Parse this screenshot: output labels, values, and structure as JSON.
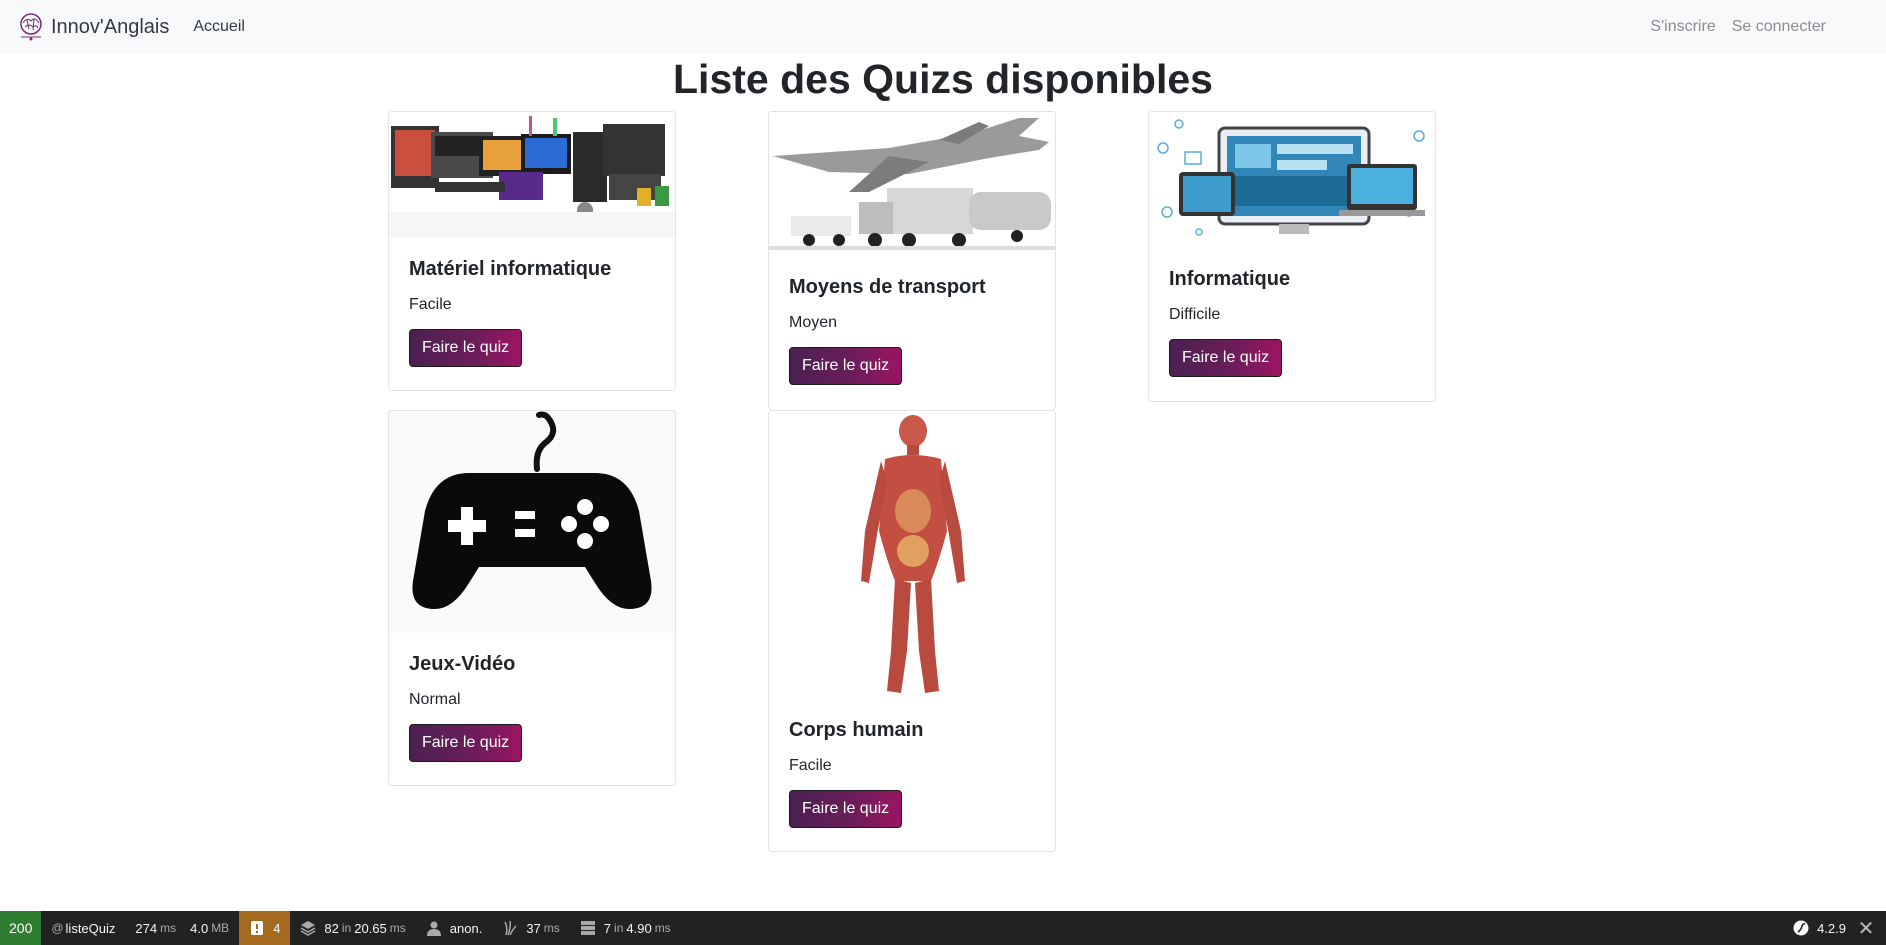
{
  "nav": {
    "brand": "Innov'Anglais",
    "home": "Accueil",
    "register": "S'inscrire",
    "login": "Se connecter"
  },
  "page_title": "Liste des Quizs disponibles",
  "quizzes": [
    {
      "title": "Matériel informatique",
      "level": "Facile",
      "button": "Faire le quiz",
      "image": "computer-hardware"
    },
    {
      "title": "Moyens de transport",
      "level": "Moyen",
      "button": "Faire le quiz",
      "image": "transport-vehicles"
    },
    {
      "title": "Informatique",
      "level": "Difficile",
      "button": "Faire le quiz",
      "image": "devices-network"
    },
    {
      "title": "Jeux-Vidéo",
      "level": "Normal",
      "button": "Faire le quiz",
      "image": "game-controller"
    },
    {
      "title": "Corps humain",
      "level": "Facile",
      "button": "Faire le quiz",
      "image": "human-anatomy"
    }
  ],
  "debug_bar": {
    "status": "200",
    "route_prefix": "@",
    "route": "listeQuiz",
    "time_value": "274",
    "time_unit": "ms",
    "memory_value": "4.0",
    "memory_unit": "MB",
    "warnings": "4",
    "queries": "82",
    "queries_in": "in",
    "queries_time": "20.65",
    "queries_unit": "ms",
    "user": "anon.",
    "twig_time": "37",
    "twig_unit": "ms",
    "cache_count": "7",
    "cache_in": "in",
    "cache_time": "4.90",
    "cache_unit": "ms",
    "version": "4.2.9"
  }
}
